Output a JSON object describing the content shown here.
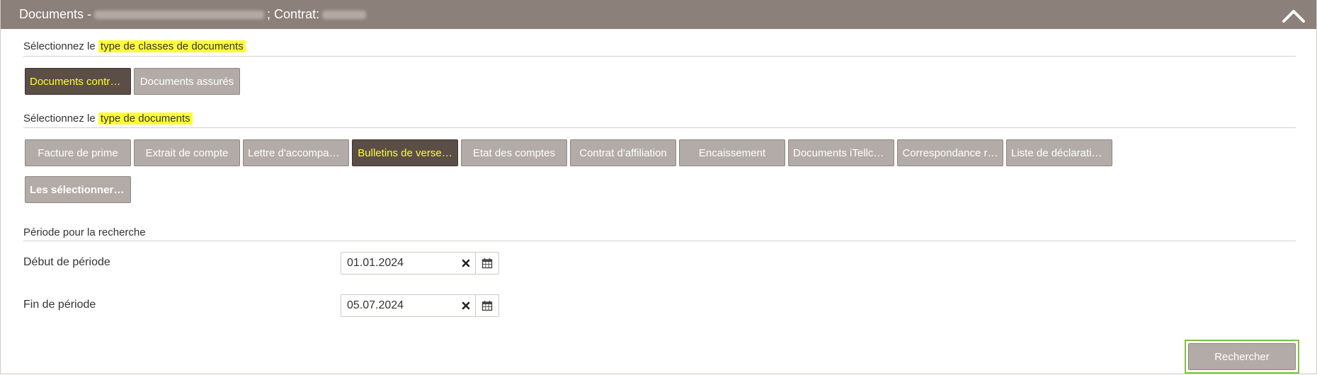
{
  "header": {
    "title_prefix": "Documents -",
    "contract_label": "; Contrat:"
  },
  "class_section": {
    "label_prefix": "Sélectionnez le ",
    "label_highlight": "type de classes de documents",
    "tiles": [
      {
        "label": "Documents contra…",
        "selected": true
      },
      {
        "label": "Documents assurés",
        "selected": false
      }
    ]
  },
  "doc_section": {
    "label_prefix": "Sélectionnez le ",
    "label_highlight": "type de documents",
    "tiles": [
      {
        "label": "Facture de prime",
        "selected": false
      },
      {
        "label": "Extrait de compte",
        "selected": false
      },
      {
        "label": "Lettre d'accompag…",
        "selected": false
      },
      {
        "label": "Bulletins de verse…",
        "selected": true
      },
      {
        "label": "Etat des comptes",
        "selected": false
      },
      {
        "label": "Contrat d'affiliation",
        "selected": false
      },
      {
        "label": "Encaissement",
        "selected": false
      },
      {
        "label": "Documents iTellco…",
        "selected": false
      },
      {
        "label": "Correspondance r…",
        "selected": false
      },
      {
        "label": "Liste de déclaratio…",
        "selected": false
      }
    ],
    "select_all_label": "Les sélectionner t…"
  },
  "period": {
    "section_label": "Période pour la recherche",
    "start_label": "Début de période",
    "start_value": "01.01.2024",
    "end_label": "Fin de période",
    "end_value": "05.07.2024"
  },
  "search_label": "Rechercher",
  "colors": {
    "header_bg": "#8c807a",
    "tile_bg": "#b3aba7",
    "tile_selected_bg": "#5a4e46",
    "highlight": "#ffff33",
    "focus_outline": "#7fc241"
  }
}
